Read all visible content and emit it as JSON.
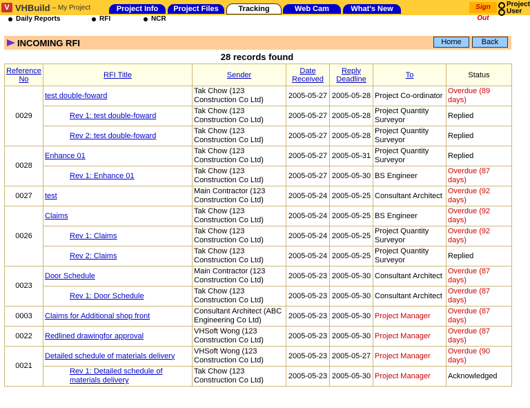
{
  "app": {
    "logo_mark": "V",
    "brand": "VHBuild",
    "project": "– My Project"
  },
  "tabs": [
    {
      "label": "Project Info"
    },
    {
      "label": "Project Files"
    },
    {
      "label": "Tracking"
    },
    {
      "label": "Web Cam"
    },
    {
      "label": "What's New"
    }
  ],
  "signout_label": "Sign Out",
  "user_label": {
    "line1": "Project",
    "line2": "User"
  },
  "subnav": [
    {
      "label": "Daily Reports"
    },
    {
      "label": "RFI"
    },
    {
      "label": "NCR"
    }
  ],
  "section_title": "INCOMING RFI",
  "buttons": {
    "home": "Home",
    "back": "Back"
  },
  "records_found": "28 records found",
  "columns": [
    "Reference No",
    "RFI Title",
    "Sender",
    "Date Received",
    "Reply Deadline",
    "To",
    "Status"
  ],
  "colors": {
    "tab_blue": "#0000cc",
    "top_bar": "#ffcc33",
    "section_bg": "#ffcc99",
    "overdue_red": "#cc0000"
  },
  "rows": [
    {
      "ref": "0029",
      "title": "test double-foward",
      "sender": "Tak Chow (123 Construction Co Ltd)",
      "received": "2005-05-27",
      "deadline": "2005-05-28",
      "to": "Project Co-ordinator",
      "status": "Overdue (89 days)"
    },
    {
      "ref": "",
      "title": "Rev 1:  test double-foward",
      "sender": "Tak Chow (123 Construction Co Ltd)",
      "received": "2005-05-27",
      "deadline": "2005-05-28",
      "to": "Project Quantity Surveyor",
      "status": "Replied"
    },
    {
      "ref": "",
      "title": "Rev 2:  test double-foward",
      "sender": "Tak Chow (123 Construction Co Ltd)",
      "received": "2005-05-27",
      "deadline": "2005-05-28",
      "to": "Project Quantity Surveyor",
      "status": "Replied"
    },
    {
      "ref": "0028",
      "title": "Enhance 01",
      "sender": "Tak Chow (123 Construction Co Ltd)",
      "received": "2005-05-27",
      "deadline": "2005-05-31",
      "to": "Project Quantity Surveyor",
      "status": "Replied"
    },
    {
      "ref": "",
      "title": "Rev 1:  Enhance 01",
      "sender": "Tak Chow (123 Construction Co Ltd)",
      "received": "2005-05-27",
      "deadline": "2005-05-30",
      "to": "BS Engineer",
      "status": "Overdue (87 days)"
    },
    {
      "ref": "0027",
      "title": "test",
      "sender": "Main Contractor (123 Construction Co Ltd)",
      "received": "2005-05-24",
      "deadline": "2005-05-25",
      "to": "Consultant Architect",
      "status": "Overdue (92 days)"
    },
    {
      "ref": "0026",
      "title": "Claims",
      "sender": "Tak Chow (123 Construction Co Ltd)",
      "received": "2005-05-24",
      "deadline": "2005-05-25",
      "to": "BS Engineer",
      "status": "Overdue (92 days)"
    },
    {
      "ref": "",
      "title": "Rev 1:  Claims",
      "sender": "Tak Chow (123 Construction Co Ltd)",
      "received": "2005-05-24",
      "deadline": "2005-05-25",
      "to": "Project Quantity Surveyor",
      "status": "Overdue (92 days)"
    },
    {
      "ref": "",
      "title": "Rev 2:  Claims",
      "sender": "Tak Chow (123 Construction Co Ltd)",
      "received": "2005-05-24",
      "deadline": "2005-05-25",
      "to": "Project Quantity Surveyor",
      "status": "Replied"
    },
    {
      "ref": "0023",
      "title": "Door Schedule",
      "sender": "Main Contractor (123 Construction Co Ltd)",
      "received": "2005-05-23",
      "deadline": "2005-05-30",
      "to": "Consultant Architect",
      "status": "Overdue (87 days)"
    },
    {
      "ref": "",
      "title": "Rev 1:  Door Schedule",
      "sender": "Tak Chow (123 Construction Co Ltd)",
      "received": "2005-05-23",
      "deadline": "2005-05-30",
      "to": "Consultant Architect",
      "status": "Overdue (87 days)"
    },
    {
      "ref": "0003",
      "title": "Claims for Additional shop front",
      "sender": "Consultant Architect (ABC Engineering Co Ltd)",
      "received": "2005-05-23",
      "deadline": "2005-05-30",
      "to": "Project Manager",
      "status": "Overdue (87 days)"
    },
    {
      "ref": "0022",
      "title": "Redlined drawingfor approval",
      "sender": "VHSoft Wong (123 Construction Co Ltd)",
      "received": "2005-05-23",
      "deadline": "2005-05-30",
      "to": "Project Manager",
      "status": "Overdue (87 days)"
    },
    {
      "ref": "0021",
      "title": "Detailed schedule of materials delivery",
      "sender": "VHSoft Wong (123 Construction Co Ltd)",
      "received": "2005-05-23",
      "deadline": "2005-05-27",
      "to": "Project Manager",
      "status": "Overdue (90 days)"
    },
    {
      "ref": "",
      "title": "Rev 1:  Detailed schedule of materials delivery",
      "sender": "Tak Chow (123 Construction Co Ltd)",
      "received": "2005-05-23",
      "deadline": "2005-05-30",
      "to": "Project Manager",
      "status": "Acknowledged"
    }
  ]
}
